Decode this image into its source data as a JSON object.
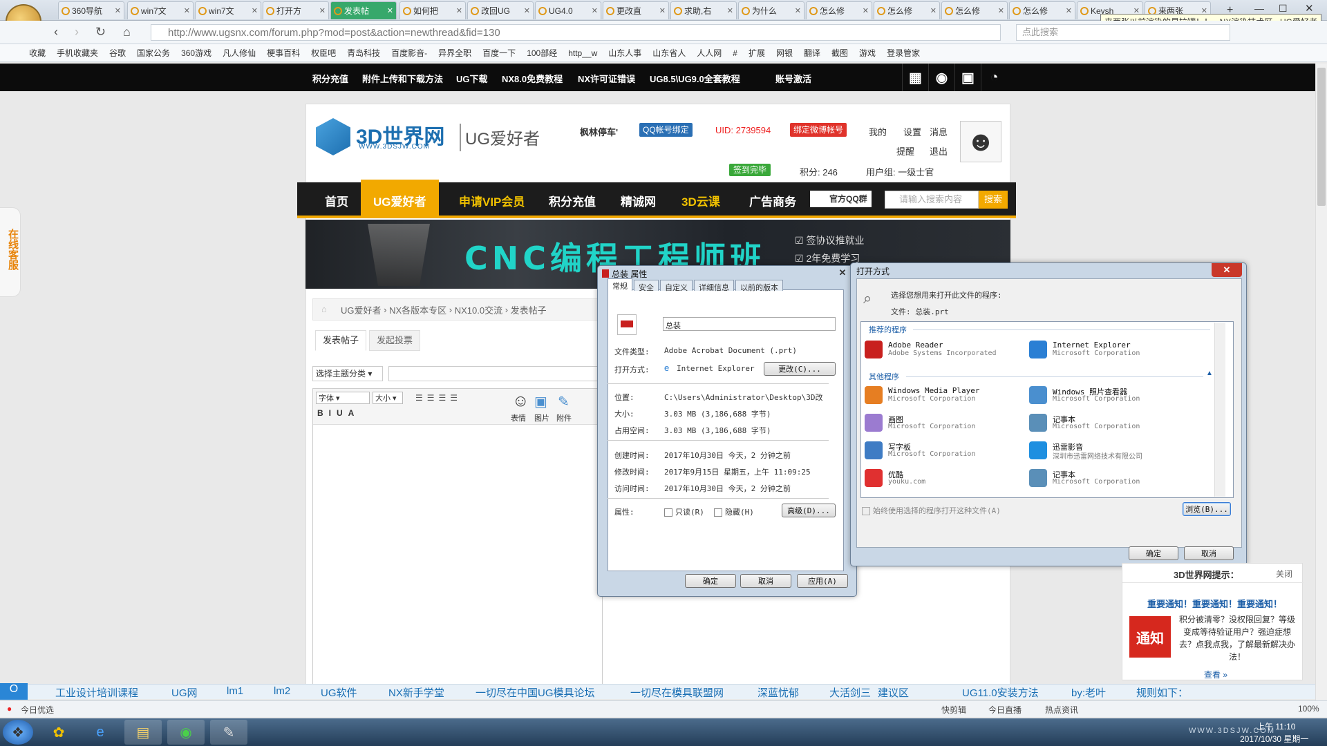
{
  "browser": {
    "tabs": [
      "360导航",
      "win7文",
      "win7文",
      "打开方",
      "发表帖",
      "如何把",
      "改回UG",
      "UG4.0",
      "更改直",
      "求助,右",
      "为什么",
      "怎么修",
      "怎么修",
      "怎么修",
      "怎么修",
      "Keysh",
      "来两张"
    ],
    "active_tab_index": 4,
    "tab_tooltip": "来两张以前渲染的易拉罐！！ - NX渲染技术区 - UG爱好者",
    "url": "http://www.ugsnx.com/forum.php?mod=post&action=newthread&fid=130",
    "search_placeholder": "点此搜索",
    "bookmarks": [
      "收藏",
      "手机收藏夹",
      "谷歌",
      "国家公务",
      "360游戏",
      "凡人修仙",
      "梗事百科",
      "权臣吧",
      "青岛科技",
      "百度影音-",
      "异界全职",
      "百度一下",
      "100部经",
      "http__w",
      "山东人事",
      "山东省人",
      "人人网",
      "#",
      "扩展",
      "网银",
      "翻译",
      "截图",
      "游戏",
      "登录管家"
    ]
  },
  "site_top": {
    "links": [
      "积分充值",
      "附件上传和下载方法",
      "UG下载",
      "NX8.0免费教程",
      "NX许可证错误",
      "UG8.5\\UG9.0全套教程",
      "账号激活"
    ]
  },
  "header": {
    "logo_text": "3D世界网",
    "logo_sub": "WWW.3DSJW.COM",
    "section": "UG爱好者",
    "username": "枫林停车'",
    "qq_bind": "QQ帐号绑定",
    "uid": "UID: 2739594",
    "weibo_bind": "绑定微博帐号",
    "menu": [
      "我的",
      "设置",
      "消息",
      "提醒",
      "退出"
    ],
    "signed": "签到完毕",
    "score": "积分: 246",
    "group": "用户组: 一级士官"
  },
  "nav": {
    "items": [
      "首页",
      "UG爱好者",
      "申请VIP会员",
      "积分充值",
      "精诚网",
      "3D云课",
      "广告商务"
    ],
    "qq_group": "官方QQ群",
    "search_placeholder": "请输入搜索内容",
    "search_btn": "搜索"
  },
  "banner": {
    "title": "CNC编程工程师班",
    "check1": "签协议推就业",
    "check2": "2年免费学习"
  },
  "side_service": "在线客服",
  "breadcrumb": [
    "UG爱好者",
    "NX各版本专区",
    "NX10.0交流",
    "发表帖子"
  ],
  "post_tabs": [
    "发表帖子",
    "发起投票"
  ],
  "topic_select": "选择主题分类",
  "editor_toolbar": {
    "font": "字体",
    "size": "大小",
    "emoji": "表情",
    "image": "图片",
    "attach": "附件"
  },
  "props": {
    "title": "总装 属性",
    "tabs": [
      "常规",
      "安全",
      "自定义",
      "详细信息",
      "以前的版本"
    ],
    "name": "总装",
    "rows": [
      {
        "k": "文件类型:",
        "v": "Adobe Acrobat Document (.prt)"
      },
      {
        "k": "打开方式:",
        "v": "Internet Explorer"
      },
      {
        "k": "位置:",
        "v": "C:\\Users\\Administrator\\Desktop\\3D改"
      },
      {
        "k": "大小:",
        "v": "3.03 MB (3,186,688 字节)"
      },
      {
        "k": "占用空间:",
        "v": "3.03 MB (3,186,688 字节)"
      },
      {
        "k": "创建时间:",
        "v": "2017年10月30日 今天，2 分钟之前"
      },
      {
        "k": "修改时间:",
        "v": "2017年9月15日 星期五，上午 11:09:25"
      },
      {
        "k": "访问时间:",
        "v": "2017年10月30日 今天，2 分钟之前"
      }
    ],
    "change_btn": "更改(C)...",
    "attr_label": "属性:",
    "readonly": "只读(R)",
    "hidden": "隐藏(H)",
    "advanced": "高级(D)...",
    "ok": "确定",
    "cancel": "取消",
    "apply": "应用(A)"
  },
  "openwith": {
    "title": "打开方式",
    "prompt": "选择您想用来打开此文件的程序:",
    "file": "文件:  总装.prt",
    "recommended": "推荐的程序",
    "other": "其他程序",
    "programs_rec": [
      {
        "name": "Adobe Reader",
        "co": "Adobe Systems Incorporated",
        "color": "#c8201e"
      },
      {
        "name": "Internet Explorer",
        "co": "Microsoft Corporation",
        "color": "#2a7fd4"
      }
    ],
    "programs_other": [
      {
        "name": "Windows Media Player",
        "co": "Microsoft Corporation",
        "color": "#e67e22"
      },
      {
        "name": "Windows 照片查看器",
        "co": "Microsoft Corporation",
        "color": "#4a8fcf"
      },
      {
        "name": "画图",
        "co": "Microsoft Corporation",
        "color": "#9b7bd0"
      },
      {
        "name": "记事本",
        "co": "Microsoft Corporation",
        "color": "#5a8fb8"
      },
      {
        "name": "写字板",
        "co": "Microsoft Corporation",
        "color": "#3f7cc4"
      },
      {
        "name": "迅雷影音",
        "co": "深圳市迅雷网络技术有限公司",
        "color": "#1e8fe0"
      },
      {
        "name": "优酷",
        "co": "youku.com",
        "color": "#e03030"
      },
      {
        "name": "记事本",
        "co": "Microsoft Corporation",
        "color": "#5a8fb8"
      }
    ],
    "always": "始终使用选择的程序打开这种文件(A)",
    "browse": "浏览(B)...",
    "ok": "确定",
    "cancel": "取消"
  },
  "notice": {
    "head": "3D世界网提示：",
    "close": "关闭",
    "title": "重要通知！重要通知！重要通知！",
    "badge": "通知",
    "body": "积分被清零？没权限回复？等级变成等待验证用户？强迫症想去？点我点我，了解最新解决办法！",
    "more": "查看 »"
  },
  "linkbar": [
    "工业设计培训课程",
    "UG网",
    "lm1",
    "lm2",
    "UG软件",
    "NX新手学堂",
    "一切尽在中国UG模具论坛",
    "一切尽在模具联盟网",
    "深蓝忧郁",
    "大活剑三",
    "建议区",
    "UG11.0安装方法",
    "by:老叶",
    "规则如下："
  ],
  "status": {
    "left": "今日优选",
    "items": [
      "快剪辑",
      "今日直播",
      "热点资讯"
    ],
    "zoom": "100%"
  },
  "taskbar": {
    "time": "上午 11:10",
    "date": "2017/10/30 星期一",
    "watermark": "WWW.3DSJW.COM"
  }
}
